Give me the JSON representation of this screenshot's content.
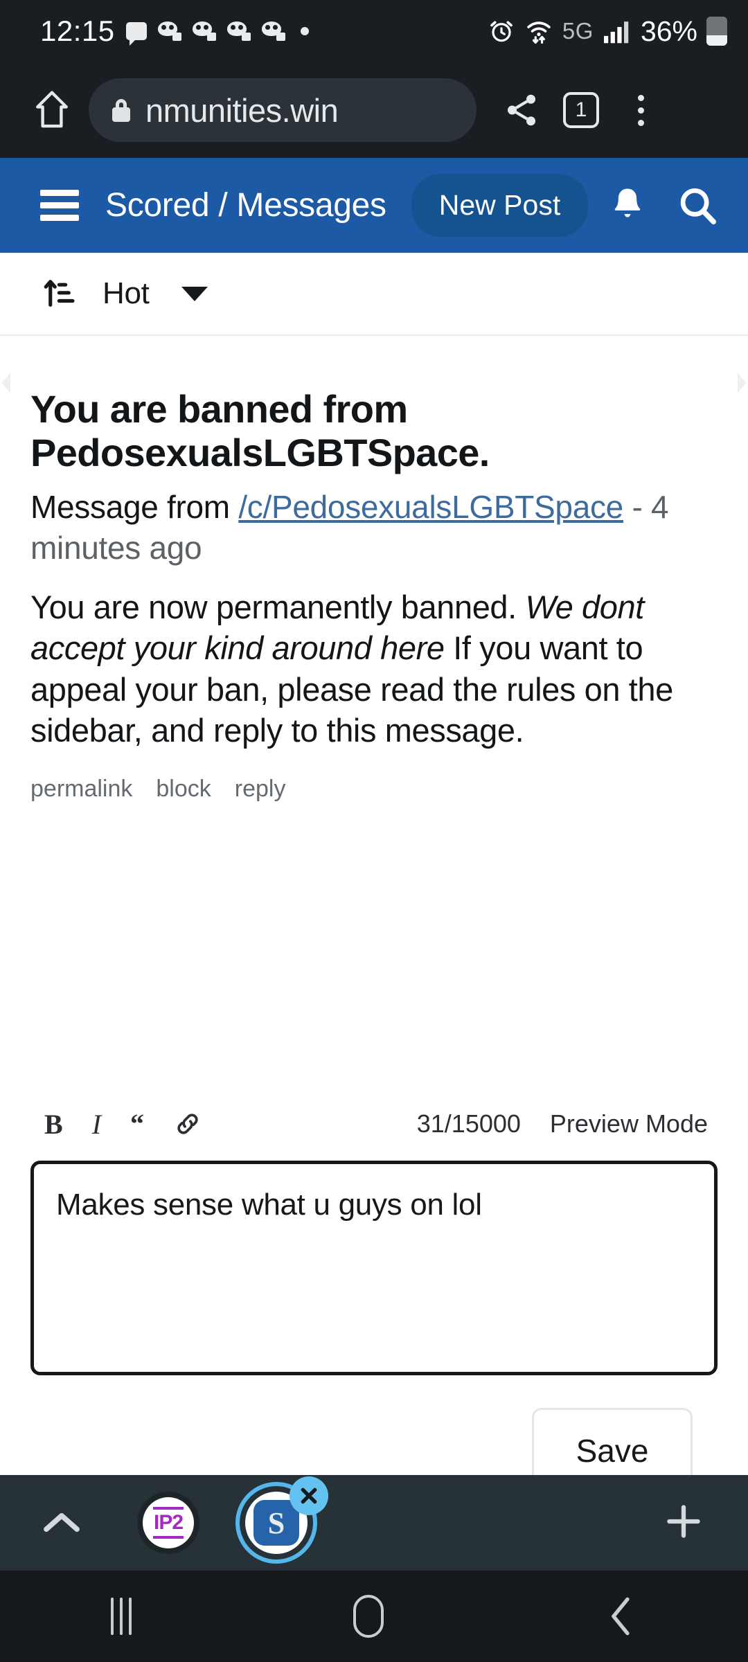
{
  "status_bar": {
    "time": "12:15",
    "notification_icons": [
      "chat-bubble-icon",
      "game-icon",
      "game-icon",
      "game-icon",
      "game-icon",
      "dot-icon"
    ],
    "alarm": "alarm-icon",
    "wifi": "wifi-icon",
    "network": "5G",
    "signal": "signal-bars-icon",
    "battery_percent": "36%",
    "battery_level": 36
  },
  "browser": {
    "home_icon": "home-icon",
    "lock_icon": "lock-icon",
    "url": "nmunities.win",
    "share_icon": "share-icon",
    "tab_count": "1",
    "menu_icon": "more-vertical-icon"
  },
  "app_header": {
    "menu_icon": "hamburger-icon",
    "title": "Scored / Messages",
    "new_post_label": "New Post",
    "bell_icon": "bell-icon",
    "search_icon": "search-icon",
    "background": "#1c5aa6",
    "button_background": "#14538f"
  },
  "sort_bar": {
    "sort_icon": "sort-ascending-icon",
    "selected": "Hot",
    "chevron": "chevron-down-icon"
  },
  "message": {
    "title": "You are banned from PedosexualsLGBTSpace.",
    "meta_prefix": "Message from",
    "community": "/c/PedosexualsLGBTSpace",
    "timestamp": " - 4 minutes ago",
    "body_line_1": "You are now permanently banned.",
    "body_italic": "We dont accept your kind around here",
    "body_line_2": "If you want to appeal your ban, please read the rules on the sidebar, and reply to this message.",
    "actions": [
      "permalink",
      "block",
      "reply"
    ],
    "link_color": "#3d6b9e"
  },
  "editor": {
    "bold_label": "B",
    "italic_label": "I",
    "quote_label": "“",
    "link_icon": "link-icon",
    "counter": "31/15000",
    "preview_mode_label": "Preview Mode",
    "textarea_value": "Makes sense what u guys on lol",
    "textarea_placeholder": "",
    "save_label": "Save"
  },
  "dock": {
    "collapse_icon": "chevron-up-icon",
    "apps": [
      {
        "name": "ip2-app-icon",
        "label": "IP2",
        "color": "#a32bbf"
      },
      {
        "name": "scored-app-icon",
        "label": "S",
        "color": "#2563ab",
        "active": true,
        "close_icon": "close-icon"
      }
    ],
    "add_icon": "plus-icon",
    "background": "#263238"
  },
  "nav_bar": {
    "recents_icon": "recents-icon",
    "home_icon": "home-square-icon",
    "back_icon": "back-chevron-icon"
  }
}
